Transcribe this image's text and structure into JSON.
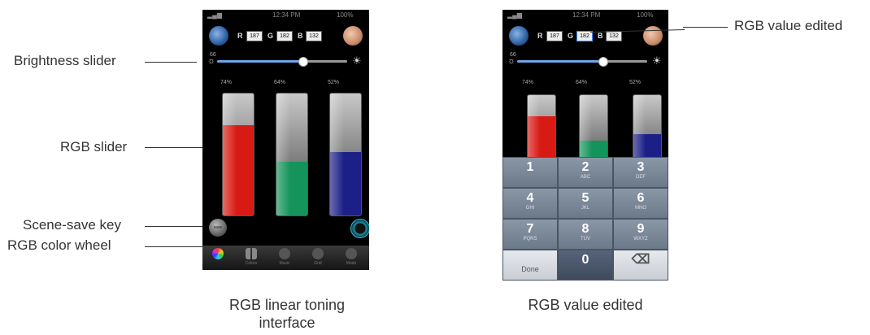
{
  "callouts": {
    "brightness_slider": "Brightness slider",
    "rgb_slider": "RGB slider",
    "scene_save_key": "Scene-save key",
    "rgb_color_wheel": "RGB color wheel",
    "rgb_value_edited": "RGB value edited"
  },
  "captions": {
    "left_line1": "RGB linear toning",
    "left_line2": "interface",
    "right": "RGB value edited"
  },
  "phone_left": {
    "status_time": "12:34 PM",
    "status_battery": "100%",
    "rgb_labels": [
      "R",
      "G",
      "B"
    ],
    "rgb_values": [
      "187",
      "182",
      "132"
    ],
    "brightness_label": "66",
    "brightness_level": 0.66,
    "slider_pcts": [
      "74%",
      "64%",
      "52%"
    ],
    "slider_levels": [
      0.74,
      0.44,
      0.52
    ],
    "slider_colors": [
      "#d81a14",
      "#14935a",
      "#1c1f86"
    ],
    "scene_save_label": "save",
    "tabs": [
      "",
      "Colors",
      "Music",
      "Grid",
      "Mode"
    ]
  },
  "phone_right": {
    "status_time": "12:34 PM",
    "status_battery": "100%",
    "rgb_labels": [
      "R",
      "G",
      "B"
    ],
    "rgb_values": [
      "187",
      "182",
      "132"
    ],
    "brightness_label": "66",
    "brightness_level": 0.66,
    "slider_pcts": [
      "74%",
      "64%",
      "52%"
    ],
    "slider_levels": [
      0.74,
      0.44,
      0.52
    ],
    "slider_colors": [
      "#d81a14",
      "#14935a",
      "#1c1f86"
    ],
    "keys": [
      {
        "n": "1",
        "s": ""
      },
      {
        "n": "2",
        "s": "ABC"
      },
      {
        "n": "3",
        "s": "DEF"
      },
      {
        "n": "4",
        "s": "GHI"
      },
      {
        "n": "5",
        "s": "JKL"
      },
      {
        "n": "6",
        "s": "MNO"
      },
      {
        "n": "7",
        "s": "PQRS"
      },
      {
        "n": "8",
        "s": "TUV"
      },
      {
        "n": "9",
        "s": "WXYZ"
      },
      {
        "n": "Done",
        "s": ""
      },
      {
        "n": "0",
        "s": ""
      },
      {
        "n": "⌫",
        "s": ""
      }
    ]
  }
}
